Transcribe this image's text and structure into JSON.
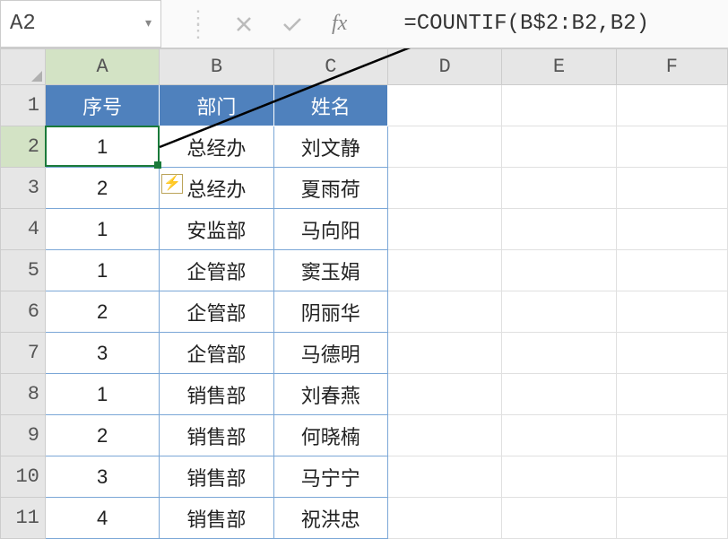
{
  "name_box": {
    "value": "A2"
  },
  "formula_bar": {
    "fx": "fx",
    "formula": "=COUNTIF(B$2:B2,B2)"
  },
  "columns": [
    "A",
    "B",
    "C",
    "D",
    "E",
    "F"
  ],
  "rows": [
    "1",
    "2",
    "3",
    "4",
    "5",
    "6",
    "7",
    "8",
    "9",
    "10",
    "11"
  ],
  "headers": {
    "A": "序号",
    "B": "部门",
    "C": "姓名"
  },
  "data": [
    {
      "A": "1",
      "B": "总经办",
      "C": "刘文静"
    },
    {
      "A": "2",
      "B": "总经办",
      "C": "夏雨荷"
    },
    {
      "A": "1",
      "B": "安监部",
      "C": "马向阳"
    },
    {
      "A": "1",
      "B": "企管部",
      "C": "窦玉娟"
    },
    {
      "A": "2",
      "B": "企管部",
      "C": "阴丽华"
    },
    {
      "A": "3",
      "B": "企管部",
      "C": "马德明"
    },
    {
      "A": "1",
      "B": "销售部",
      "C": "刘春燕"
    },
    {
      "A": "2",
      "B": "销售部",
      "C": "何晓楠"
    },
    {
      "A": "3",
      "B": "销售部",
      "C": "马宁宁"
    },
    {
      "A": "4",
      "B": "销售部",
      "C": "祝洪忠"
    }
  ],
  "selected_cell": {
    "row": 2,
    "col": "A"
  },
  "autofill_button": {
    "icon": "⚡"
  }
}
